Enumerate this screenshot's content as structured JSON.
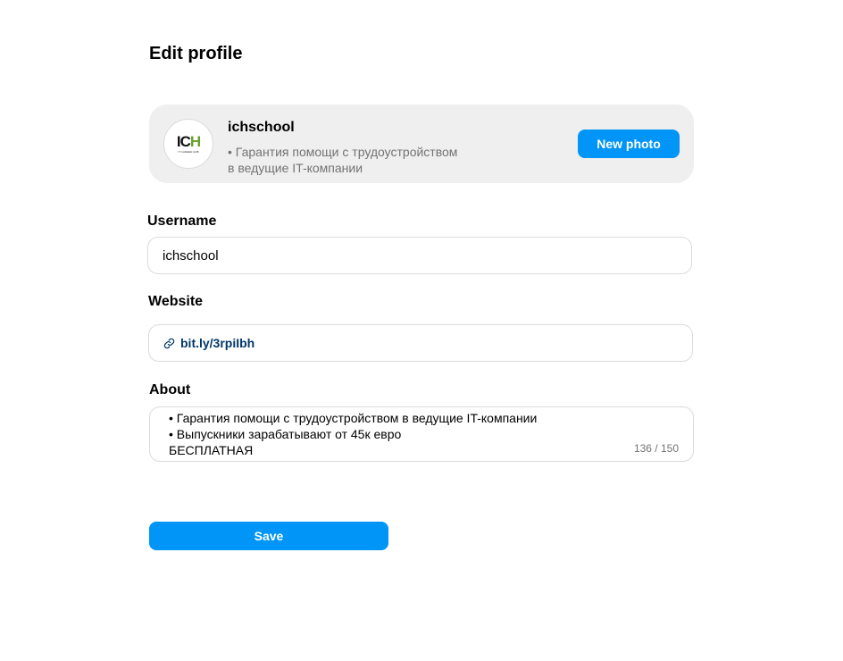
{
  "page": {
    "title": "Edit profile"
  },
  "profile": {
    "avatar_logo_main": "IC",
    "avatar_logo_accent": "H",
    "avatar_logo_sub": "IT CAREER HUB",
    "name": "ichschool",
    "bio_line1": "• Гарантия помощи с трудоустройством",
    "bio_line2": "в ведущие IT-компании",
    "new_photo_label": "New photo"
  },
  "form": {
    "username": {
      "label": "Username",
      "value": "ichschool"
    },
    "website": {
      "label": "Website",
      "value": "bit.ly/3rpiIbh",
      "icon": "link-icon"
    },
    "about": {
      "label": "About",
      "lines": [
        "• Гарантия помощи с трудоустройством в ведущие IT-компании",
        "• Выпускники зарабатывают от 45к евро",
        "БЕСПЛАТНАЯ"
      ],
      "counter": "136 / 150"
    },
    "save_label": "Save"
  },
  "colors": {
    "accent_blue": "#0095f6",
    "link_blue": "#00376b",
    "card_bg": "#efefef",
    "border": "#dbdbdb",
    "muted_text": "#737373"
  }
}
